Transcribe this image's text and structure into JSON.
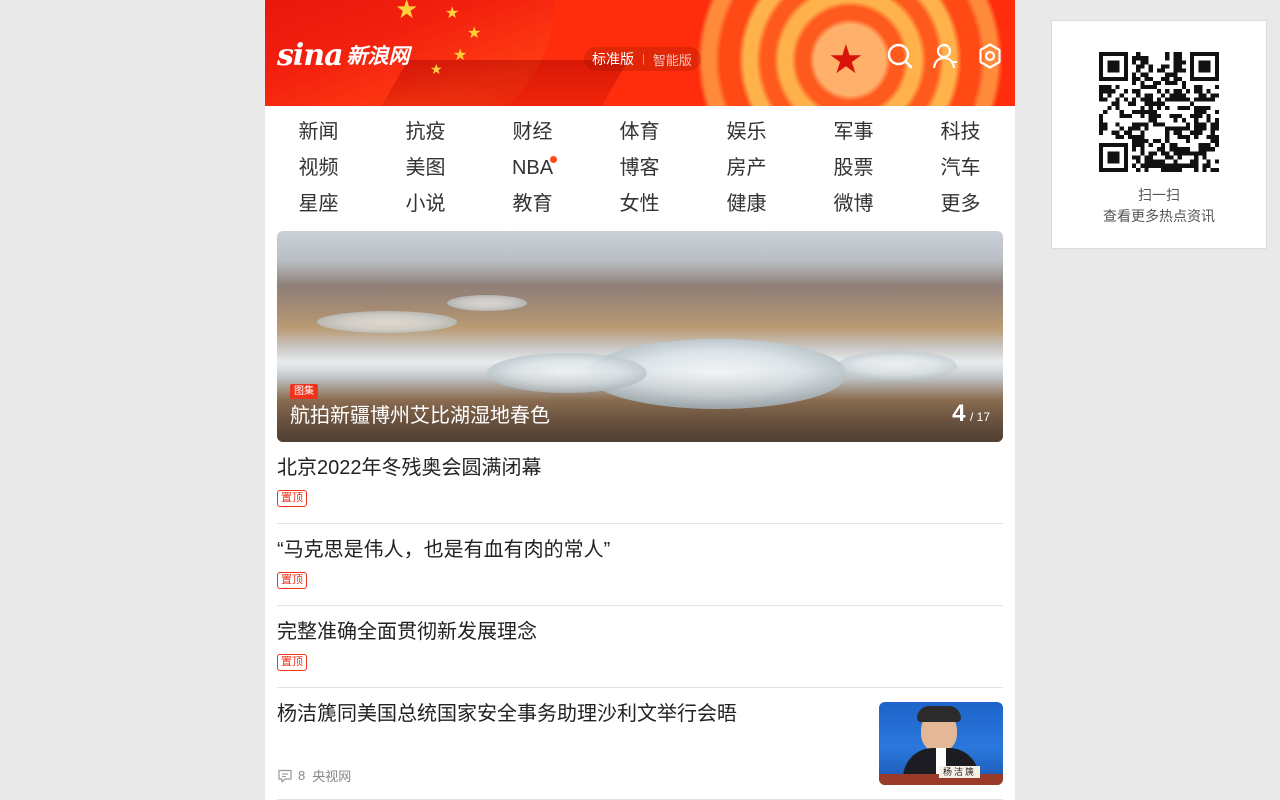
{
  "header": {
    "logo_mark": "sina",
    "logo_text": "新浪网",
    "version_standard": "标准版",
    "version_smart": "智能版",
    "icons": [
      "search-icon",
      "user-icon",
      "settings-icon"
    ]
  },
  "nav": {
    "items": [
      {
        "label": "新闻"
      },
      {
        "label": "抗疫"
      },
      {
        "label": "财经"
      },
      {
        "label": "体育"
      },
      {
        "label": "娱乐"
      },
      {
        "label": "军事"
      },
      {
        "label": "科技"
      },
      {
        "label": "视频"
      },
      {
        "label": "美图"
      },
      {
        "label": "NBA",
        "dot": true
      },
      {
        "label": "博客"
      },
      {
        "label": "房产"
      },
      {
        "label": "股票"
      },
      {
        "label": "汽车"
      },
      {
        "label": "星座"
      },
      {
        "label": "小说"
      },
      {
        "label": "教育"
      },
      {
        "label": "女性"
      },
      {
        "label": "健康"
      },
      {
        "label": "微博"
      },
      {
        "label": "更多"
      }
    ]
  },
  "hero": {
    "tag": "图集",
    "title": "航拍新疆博州艾比湖湿地春色",
    "current": "4",
    "total": "/ 17"
  },
  "news": [
    {
      "title": "北京2022年冬残奥会圆满闭幕",
      "badge": "置顶"
    },
    {
      "title": "“马克思是伟人，也是有血有肉的常人”",
      "badge": "置顶"
    },
    {
      "title": "完整准确全面贯彻新发展理念",
      "badge": "置顶"
    },
    {
      "title": "杨洁篪同美国总统国家安全事务助理沙利文举行会晤",
      "comments": "8",
      "source": "央视网",
      "thumb_caption": "杨洁篪"
    }
  ],
  "qr": {
    "line1": "扫一扫",
    "line2": "查看更多热点资讯"
  },
  "colors": {
    "brand_red": "#f0331c",
    "header_red": "#ff2d0c",
    "star_gold": "#ffd23a"
  }
}
